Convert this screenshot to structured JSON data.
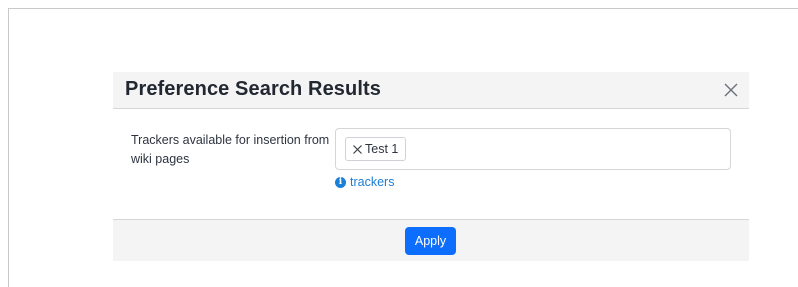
{
  "modal": {
    "title": "Preference Search Results",
    "close_icon": "close-icon"
  },
  "preference": {
    "label": "Trackers available for insertion from wiki pages",
    "selected_items": [
      {
        "label": "Test 1",
        "remove_icon": "x-icon"
      }
    ],
    "help": {
      "icon": "info-icon",
      "icon_glyph": "i",
      "text": "trackers"
    }
  },
  "footer": {
    "apply_label": "Apply"
  },
  "colors": {
    "primary_button": "#0d6efd",
    "link": "#1a7fd6",
    "header_bg": "#f4f4f5"
  }
}
